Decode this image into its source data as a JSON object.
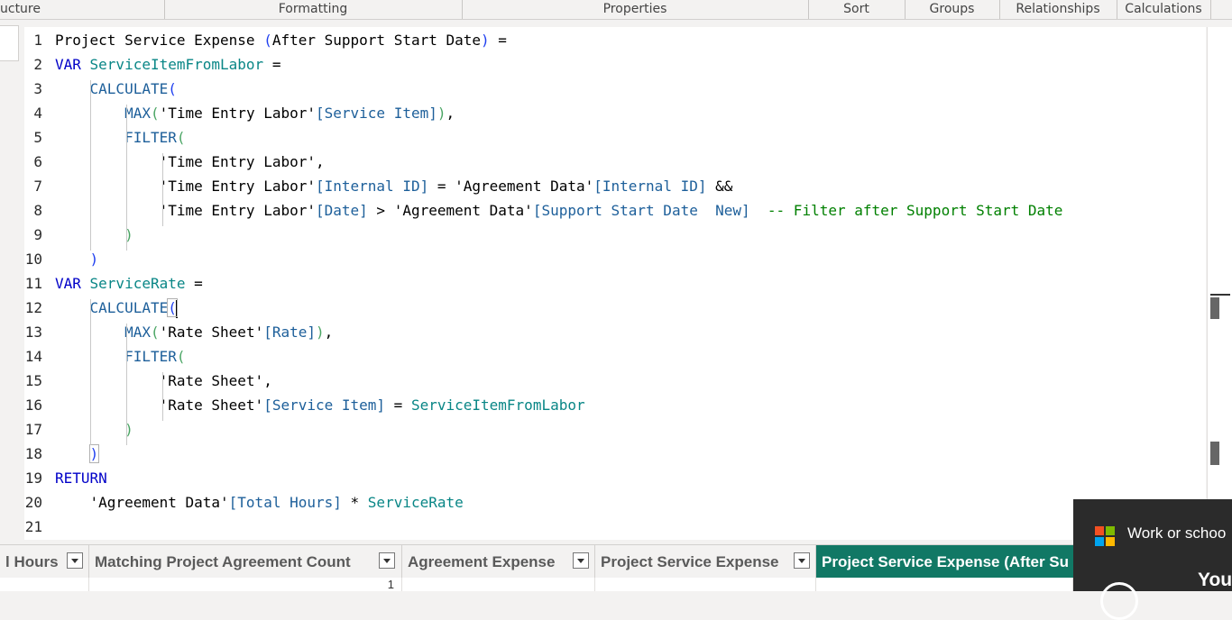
{
  "ribbon": {
    "groups": [
      "ucture",
      "Formatting",
      "Properties",
      "Sort",
      "Groups",
      "Relationships",
      "Calculations"
    ]
  },
  "editor": {
    "lines": [
      {
        "n": "1",
        "tokens": [
          {
            "t": "Project Service Expense ",
            "c": ""
          },
          {
            "t": "(",
            "c": "p1"
          },
          {
            "t": "After Support Start Date",
            "c": ""
          },
          {
            "t": ")",
            "c": "p1"
          },
          {
            "t": " =",
            "c": ""
          }
        ]
      },
      {
        "n": "2",
        "tokens": [
          {
            "t": "VAR ",
            "c": "kw"
          },
          {
            "t": "ServiceItemFromLabor",
            "c": "var"
          },
          {
            "t": " =",
            "c": ""
          }
        ]
      },
      {
        "n": "3",
        "tokens": [
          {
            "t": "    ",
            "c": ""
          },
          {
            "t": "CALCULATE",
            "c": "fn"
          },
          {
            "t": "(",
            "c": "p1"
          }
        ]
      },
      {
        "n": "4",
        "tokens": [
          {
            "t": "        ",
            "c": ""
          },
          {
            "t": "MAX",
            "c": "fn"
          },
          {
            "t": "(",
            "c": "p2"
          },
          {
            "t": "'Time Entry Labor'",
            "c": ""
          },
          {
            "t": "[Service Item]",
            "c": "fn"
          },
          {
            "t": ")",
            "c": "p2"
          },
          {
            "t": ",",
            "c": ""
          }
        ]
      },
      {
        "n": "5",
        "tokens": [
          {
            "t": "        ",
            "c": ""
          },
          {
            "t": "FILTER",
            "c": "fn"
          },
          {
            "t": "(",
            "c": "p2"
          }
        ]
      },
      {
        "n": "6",
        "tokens": [
          {
            "t": "            ",
            "c": ""
          },
          {
            "t": "'Time Entry Labor'",
            "c": ""
          },
          {
            "t": ",",
            "c": ""
          }
        ]
      },
      {
        "n": "7",
        "tokens": [
          {
            "t": "            ",
            "c": ""
          },
          {
            "t": "'Time Entry Labor'",
            "c": ""
          },
          {
            "t": "[Internal ID]",
            "c": "fn"
          },
          {
            "t": " = ",
            "c": ""
          },
          {
            "t": "'Agreement Data'",
            "c": ""
          },
          {
            "t": "[Internal ID]",
            "c": "fn"
          },
          {
            "t": " &&",
            "c": ""
          }
        ]
      },
      {
        "n": "8",
        "tokens": [
          {
            "t": "            ",
            "c": ""
          },
          {
            "t": "'Time Entry Labor'",
            "c": ""
          },
          {
            "t": "[Date]",
            "c": "fn"
          },
          {
            "t": " > ",
            "c": ""
          },
          {
            "t": "'Agreement Data'",
            "c": ""
          },
          {
            "t": "[Support Start Date  New]",
            "c": "fn"
          },
          {
            "t": "  -- Filter after Support Start Date",
            "c": "cmt"
          }
        ]
      },
      {
        "n": "9",
        "tokens": [
          {
            "t": "        ",
            "c": ""
          },
          {
            "t": ")",
            "c": "p2"
          }
        ]
      },
      {
        "n": "10",
        "tokens": [
          {
            "t": "    ",
            "c": ""
          },
          {
            "t": ")",
            "c": "p1"
          }
        ]
      },
      {
        "n": "11",
        "tokens": [
          {
            "t": "VAR ",
            "c": "kw"
          },
          {
            "t": "ServiceRate",
            "c": "var"
          },
          {
            "t": " =",
            "c": ""
          }
        ]
      },
      {
        "n": "12",
        "tokens": [
          {
            "t": "    ",
            "c": ""
          },
          {
            "t": "CALCULATE",
            "c": "fn"
          },
          {
            "t": "(",
            "c": "p1 bracket-hl"
          }
        ],
        "cursor": true
      },
      {
        "n": "13",
        "tokens": [
          {
            "t": "        ",
            "c": ""
          },
          {
            "t": "MAX",
            "c": "fn"
          },
          {
            "t": "(",
            "c": "p2"
          },
          {
            "t": "'Rate Sheet'",
            "c": ""
          },
          {
            "t": "[Rate]",
            "c": "fn"
          },
          {
            "t": ")",
            "c": "p2"
          },
          {
            "t": ",",
            "c": ""
          }
        ]
      },
      {
        "n": "14",
        "tokens": [
          {
            "t": "        ",
            "c": ""
          },
          {
            "t": "FILTER",
            "c": "fn"
          },
          {
            "t": "(",
            "c": "p2"
          }
        ]
      },
      {
        "n": "15",
        "tokens": [
          {
            "t": "            ",
            "c": ""
          },
          {
            "t": "'Rate Sheet'",
            "c": ""
          },
          {
            "t": ",",
            "c": ""
          }
        ]
      },
      {
        "n": "16",
        "tokens": [
          {
            "t": "            ",
            "c": ""
          },
          {
            "t": "'Rate Sheet'",
            "c": ""
          },
          {
            "t": "[Service Item]",
            "c": "fn"
          },
          {
            "t": " = ",
            "c": ""
          },
          {
            "t": "ServiceItemFromLabor",
            "c": "var"
          }
        ]
      },
      {
        "n": "17",
        "tokens": [
          {
            "t": "        ",
            "c": ""
          },
          {
            "t": ")",
            "c": "p2"
          }
        ]
      },
      {
        "n": "18",
        "tokens": [
          {
            "t": "    ",
            "c": ""
          },
          {
            "t": ")",
            "c": "p1 bracket-hl"
          }
        ]
      },
      {
        "n": "19",
        "tokens": [
          {
            "t": "RETURN",
            "c": "kw"
          }
        ]
      },
      {
        "n": "20",
        "tokens": [
          {
            "t": "    ",
            "c": ""
          },
          {
            "t": "'Agreement Data'",
            "c": ""
          },
          {
            "t": "[Total Hours]",
            "c": "fn"
          },
          {
            "t": " * ",
            "c": ""
          },
          {
            "t": "ServiceRate",
            "c": "var"
          }
        ]
      },
      {
        "n": "21",
        "tokens": []
      }
    ]
  },
  "table": {
    "columns": [
      {
        "label": "l Hours",
        "active": false
      },
      {
        "label": "Matching Project Agreement Count",
        "active": false
      },
      {
        "label": "Agreement Expense",
        "active": false
      },
      {
        "label": "Project Service Expense",
        "active": false
      },
      {
        "label": "Project Service Expense (After Su",
        "active": true
      }
    ],
    "first_row": [
      "",
      "1",
      "",
      "",
      ""
    ]
  },
  "toast": {
    "title": "Work or schoo",
    "sub": "You"
  },
  "colors": {
    "active_column": "#117865",
    "keyword": "#0000c8",
    "function": "#1d5f9a",
    "variable": "#098686",
    "comment": "#008000"
  }
}
